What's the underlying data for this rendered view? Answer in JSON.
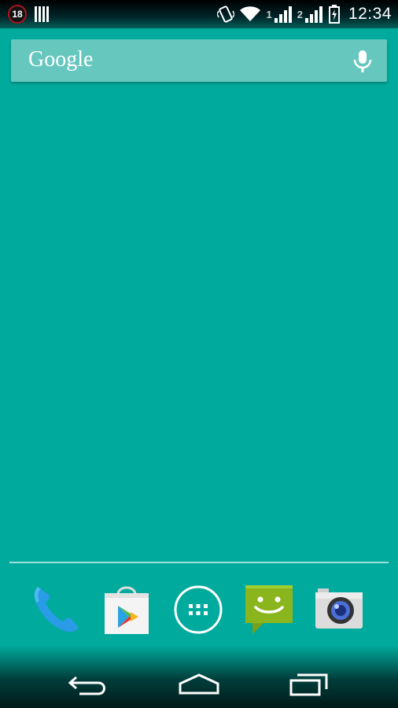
{
  "status_bar": {
    "notification_badge": "18",
    "sim1_label": "1",
    "sim2_label": "2",
    "time": "12:34",
    "icons": [
      "notification-18-icon",
      "barcode-icon",
      "vibrate-icon",
      "wifi-icon",
      "signal-icon",
      "signal-icon",
      "battery-charging-icon"
    ]
  },
  "search": {
    "label": "Google",
    "icon": "mic-icon"
  },
  "dock": {
    "apps": [
      "phone-icon",
      "play-store-icon",
      "app-drawer-icon",
      "messaging-icon",
      "camera-icon"
    ]
  },
  "navigation": {
    "buttons": [
      "back-icon",
      "home-icon",
      "recents-icon"
    ]
  },
  "colors": {
    "wallpaper": "#00ab9e",
    "search_bar": "#66c7be",
    "phone_blue": "#2a9be6",
    "messaging_green": "#8bb51d"
  }
}
